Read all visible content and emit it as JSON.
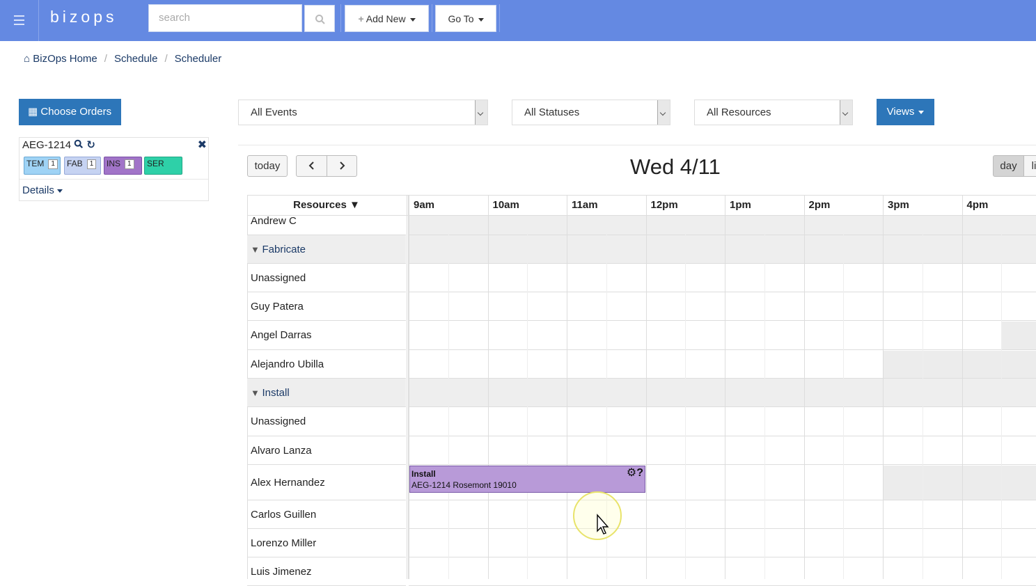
{
  "app": {
    "brand": "bizops"
  },
  "topbar": {
    "search_placeholder": "search",
    "add_new_label": "Add New",
    "goto_label": "Go To"
  },
  "breadcrumb": [
    "BizOps Home",
    "Schedule",
    "Scheduler"
  ],
  "left_panel": {
    "choose_orders_label": "Choose Orders",
    "order_id": "AEG-1214",
    "chips": [
      {
        "label": "TEM",
        "count": "1",
        "color": "#9fd3f5"
      },
      {
        "label": "FAB",
        "count": "1",
        "color": "#c6d3f2"
      },
      {
        "label": "INS",
        "count": "1",
        "color": "#a174c8"
      },
      {
        "label": "SER",
        "count": "",
        "color": "#2ed0a8"
      }
    ],
    "details_label": "Details"
  },
  "filters": {
    "events": "All Events",
    "statuses": "All Statuses",
    "resources": "All Resources",
    "views_label": "Views"
  },
  "calendar": {
    "today_label": "today",
    "title": "Wed 4/11",
    "view_day": "day",
    "view_list_partial": "li",
    "resources_header": "Resources ▼",
    "hours": [
      "9am",
      "10am",
      "11am",
      "12pm",
      "1pm",
      "2pm",
      "3pm",
      "4pm"
    ],
    "rows": [
      {
        "label": "Andrew C",
        "group": false
      },
      {
        "label": "Fabricate",
        "group": true
      },
      {
        "label": "Unassigned",
        "group": false
      },
      {
        "label": "Guy Patera",
        "group": false
      },
      {
        "label": "Angel Darras",
        "group": false
      },
      {
        "label": "Alejandro Ubilla",
        "group": false
      },
      {
        "label": "Install",
        "group": true
      },
      {
        "label": "Unassigned",
        "group": false
      },
      {
        "label": "Alvaro Lanza",
        "group": false
      },
      {
        "label": "Alex Hernandez",
        "group": false
      },
      {
        "label": "Carlos Guillen",
        "group": false
      },
      {
        "label": "Lorenzo Miller",
        "group": false
      },
      {
        "label": "Luis Jimenez",
        "group": false
      }
    ],
    "event": {
      "title": "Install",
      "detail": "AEG-1214 Rosemont 19010",
      "icon": "⚙?"
    }
  },
  "colors": {
    "topbar": "#6489e2",
    "primary": "#2d76b9",
    "event": "#b89ad8"
  }
}
